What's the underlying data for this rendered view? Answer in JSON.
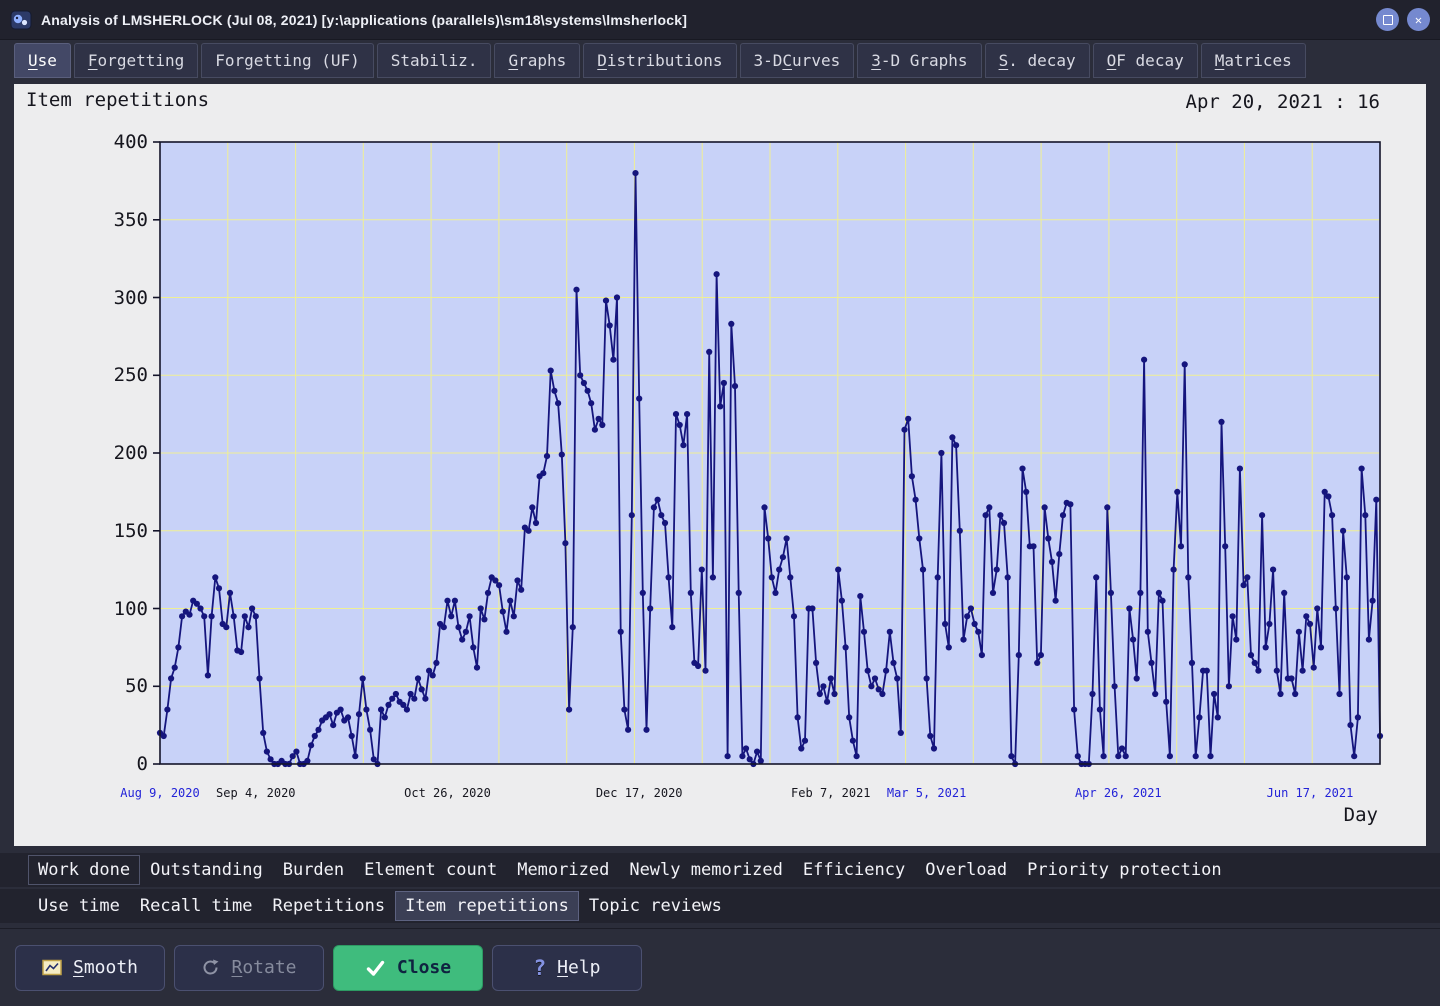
{
  "window": {
    "title": "Analysis of LMSHERLOCK (Jul 08, 2021) [y:\\applications (parallels)\\sm18\\systems\\lmsherlock]"
  },
  "tab_bar": {
    "tabs": [
      {
        "label": "Use",
        "accel_index": 0,
        "active": true
      },
      {
        "label": "Forgetting",
        "accel_index": 0,
        "active": false
      },
      {
        "label": "Forgetting (UF)",
        "accel_index": -1,
        "active": false
      },
      {
        "label": "Stabiliz.",
        "accel_index": -1,
        "active": false
      },
      {
        "label": "Graphs",
        "accel_index": 0,
        "active": false
      },
      {
        "label": "Distributions",
        "accel_index": 0,
        "active": false
      },
      {
        "label": "3-D Curves",
        "accel_index": 4,
        "active": false
      },
      {
        "label": "3-D Graphs",
        "accel_index": 0,
        "active": false
      },
      {
        "label": "S. decay",
        "accel_index": 0,
        "active": false
      },
      {
        "label": "OF decay",
        "accel_index": 0,
        "active": false
      },
      {
        "label": "Matrices",
        "accel_index": 0,
        "active": false
      }
    ]
  },
  "chart": {
    "heading": "Item repetitions",
    "readout": "Apr 20, 2021 : 16",
    "x_axis_title": "Day"
  },
  "chart_data": {
    "type": "line",
    "title": "Item repetitions",
    "xlabel": "Day",
    "ylabel": "",
    "ylim": [
      0,
      400
    ],
    "y_ticks": [
      0,
      50,
      100,
      150,
      200,
      250,
      300,
      350,
      400
    ],
    "x_unit": "days since Aug 9, 2020 (one point per day)",
    "x_tick_labels": [
      {
        "label": "Aug 9, 2020",
        "day": 0,
        "blue": true
      },
      {
        "label": "Sep 4, 2020",
        "day": 26,
        "blue": false
      },
      {
        "label": "Oct 26, 2020",
        "day": 78,
        "blue": false
      },
      {
        "label": "Dec 17, 2020",
        "day": 130,
        "blue": false
      },
      {
        "label": "Feb 7, 2021",
        "day": 182,
        "blue": false
      },
      {
        "label": "Mar 5, 2021",
        "day": 208,
        "blue": true
      },
      {
        "label": "Apr 26, 2021",
        "day": 260,
        "blue": true
      },
      {
        "label": "Jun 17, 2021",
        "day": 312,
        "blue": true
      }
    ],
    "values": [
      20,
      18,
      35,
      55,
      62,
      75,
      95,
      98,
      96,
      105,
      103,
      100,
      95,
      57,
      95,
      120,
      113,
      90,
      88,
      110,
      95,
      73,
      72,
      95,
      88,
      100,
      95,
      55,
      20,
      8,
      3,
      0,
      0,
      2,
      0,
      0,
      5,
      8,
      0,
      0,
      2,
      12,
      18,
      22,
      28,
      30,
      32,
      25,
      33,
      35,
      28,
      30,
      18,
      5,
      32,
      55,
      35,
      22,
      3,
      0,
      35,
      30,
      38,
      42,
      45,
      40,
      38,
      35,
      45,
      42,
      55,
      48,
      42,
      60,
      57,
      65,
      90,
      88,
      105,
      95,
      105,
      88,
      80,
      85,
      95,
      75,
      62,
      100,
      93,
      110,
      120,
      118,
      115,
      98,
      85,
      105,
      95,
      118,
      112,
      152,
      150,
      165,
      155,
      185,
      187,
      198,
      253,
      240,
      232,
      199,
      142,
      35,
      88,
      305,
      250,
      245,
      240,
      232,
      215,
      222,
      218,
      298,
      282,
      260,
      300,
      85,
      35,
      22,
      160,
      380,
      235,
      110,
      22,
      100,
      165,
      170,
      160,
      155,
      120,
      88,
      225,
      218,
      205,
      225,
      110,
      65,
      63,
      125,
      60,
      265,
      120,
      315,
      230,
      245,
      5,
      283,
      243,
      110,
      5,
      10,
      3,
      0,
      8,
      2,
      165,
      145,
      120,
      110,
      125,
      133,
      145,
      120,
      95,
      30,
      10,
      15,
      100,
      100,
      65,
      45,
      50,
      40,
      55,
      45,
      125,
      105,
      75,
      30,
      15,
      5,
      108,
      85,
      60,
      50,
      55,
      48,
      45,
      60,
      85,
      65,
      55,
      20,
      215,
      222,
      185,
      170,
      145,
      125,
      55,
      18,
      10,
      120,
      200,
      90,
      75,
      210,
      205,
      150,
      80,
      95,
      100,
      90,
      85,
      70,
      160,
      165,
      110,
      125,
      160,
      155,
      120,
      5,
      0,
      70,
      190,
      175,
      140,
      140,
      65,
      70,
      165,
      145,
      130,
      105,
      135,
      160,
      168,
      167,
      35,
      5,
      0,
      0,
      0,
      45,
      120,
      35,
      5,
      165,
      110,
      50,
      5,
      10,
      5,
      100,
      80,
      55,
      110,
      260,
      85,
      65,
      45,
      110,
      105,
      40,
      5,
      125,
      175,
      140,
      257,
      120,
      65,
      5,
      30,
      60,
      60,
      5,
      45,
      30,
      220,
      140,
      50,
      95,
      80,
      190,
      115,
      120,
      70,
      65,
      60,
      160,
      75,
      90,
      125,
      60,
      45,
      110,
      55,
      55,
      45,
      85,
      60,
      95,
      90,
      62,
      100,
      75,
      175,
      172,
      160,
      100,
      45,
      150,
      120,
      25,
      5,
      30,
      190,
      160,
      80,
      105,
      170,
      18
    ],
    "series_color": "#15157d",
    "plot_bg": "#c8d2f8",
    "grid_color": "#efef94",
    "axis_color": "#14142a",
    "date_blue": "#2323d8",
    "date_black": "#16161e",
    "x_grid_divisions": 18,
    "grid": true,
    "legend": false
  },
  "bottom_tabs": {
    "rows": [
      {
        "items": [
          {
            "label": "Work done",
            "active": false,
            "outlined": true
          },
          {
            "label": "Outstanding",
            "active": false,
            "outlined": false
          },
          {
            "label": "Burden",
            "active": false,
            "outlined": false
          },
          {
            "label": "Element count",
            "active": false,
            "outlined": false
          },
          {
            "label": "Memorized",
            "active": false,
            "outlined": false
          },
          {
            "label": "Newly memorized",
            "active": false,
            "outlined": false
          },
          {
            "label": "Efficiency",
            "active": false,
            "outlined": false
          },
          {
            "label": "Overload",
            "active": false,
            "outlined": false
          },
          {
            "label": "Priority protection",
            "active": false,
            "outlined": false
          }
        ]
      },
      {
        "items": [
          {
            "label": "Use time",
            "active": false,
            "outlined": false
          },
          {
            "label": "Recall time",
            "active": false,
            "outlined": false
          },
          {
            "label": "Repetitions",
            "active": false,
            "outlined": false
          },
          {
            "label": "Item repetitions",
            "active": true,
            "outlined": false
          },
          {
            "label": "Topic reviews",
            "active": false,
            "outlined": false
          }
        ]
      }
    ]
  },
  "buttons": {
    "smooth": {
      "label": "Smooth",
      "accel_index": 0
    },
    "rotate": {
      "label": "Rotate",
      "accel_index": 0
    },
    "close": {
      "label": "Close",
      "accel_index": -1
    },
    "help": {
      "label": "Help",
      "accel_index": 0
    }
  },
  "colors": {
    "close_green": "#3fbc7d",
    "series_navy": "#15157d",
    "plot_background": "#c8d2f8",
    "gridline_yellow": "#efef94",
    "date_label_blue": "#2323d8"
  }
}
